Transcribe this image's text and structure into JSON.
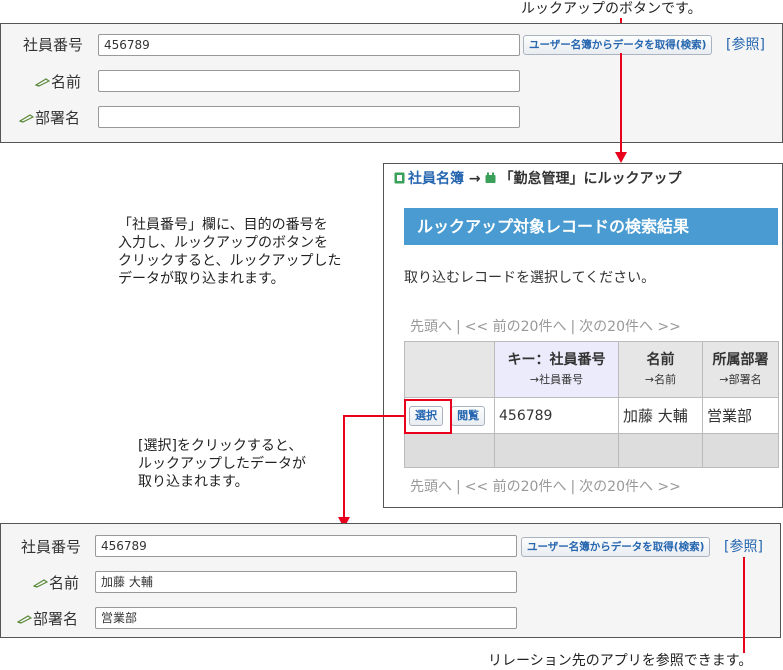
{
  "annotations": {
    "lookup_button_note": "ルックアップのボタンです。",
    "instruction_lines": [
      "「社員番号」欄に、目的の番号を",
      "入力し、ルックアップのボタンを",
      "クリックすると、ルックアップした",
      "データが取り込まれます。"
    ],
    "select_lines": [
      "[選択]をクリックすると、",
      "ルックアップしたデータが",
      "取り込まれます。"
    ],
    "reference_note": "リレーション先のアプリを参照できます。"
  },
  "form_before": {
    "employee_no_label": "社員番号",
    "employee_no_value": "456789",
    "name_label": "名前",
    "name_value": "",
    "dept_label": "部署名",
    "dept_value": "",
    "lookup_button": "ユーザー名簿からデータを取得(検索)",
    "reference_link": "[参照]"
  },
  "dialog": {
    "source_app": "社員名簿",
    "arrow": "→",
    "target_app": "「勤怠管理」にルックアップ",
    "banner": "ルックアップ対象レコードの検索結果",
    "message": "取り込むレコードを選択してください。",
    "pager": {
      "first": "先頭へ",
      "sep": "|",
      "prev": "<< 前の20件へ",
      "next": "次の20件へ >>"
    },
    "columns": [
      {
        "title": "キー：社員番号",
        "sub": "→社員番号"
      },
      {
        "title": "名前",
        "sub": "→名前"
      },
      {
        "title": "所属部署",
        "sub": "→部署名"
      }
    ],
    "select_button": "選択",
    "view_button": "閲覧",
    "row": {
      "key": "456789",
      "name": "加藤 大輔",
      "dept": "営業部"
    }
  },
  "form_after": {
    "employee_no_label": "社員番号",
    "employee_no_value": "456789",
    "name_label": "名前",
    "name_value": "加藤 大輔",
    "dept_label": "部署名",
    "dept_value": "営業部",
    "lookup_button": "ユーザー名簿からデータを取得(検索)",
    "reference_link": "[参照]"
  },
  "colors": {
    "accent_red": "#e8001c",
    "link_blue": "#2767b0",
    "banner_blue": "#4a9bd1",
    "key_column": "#ecebfb",
    "app_icon_green": "#3aa05a"
  },
  "icons": {
    "pencil": "pencil-icon",
    "source_app": "app-icon",
    "target_app": "app-icon"
  }
}
